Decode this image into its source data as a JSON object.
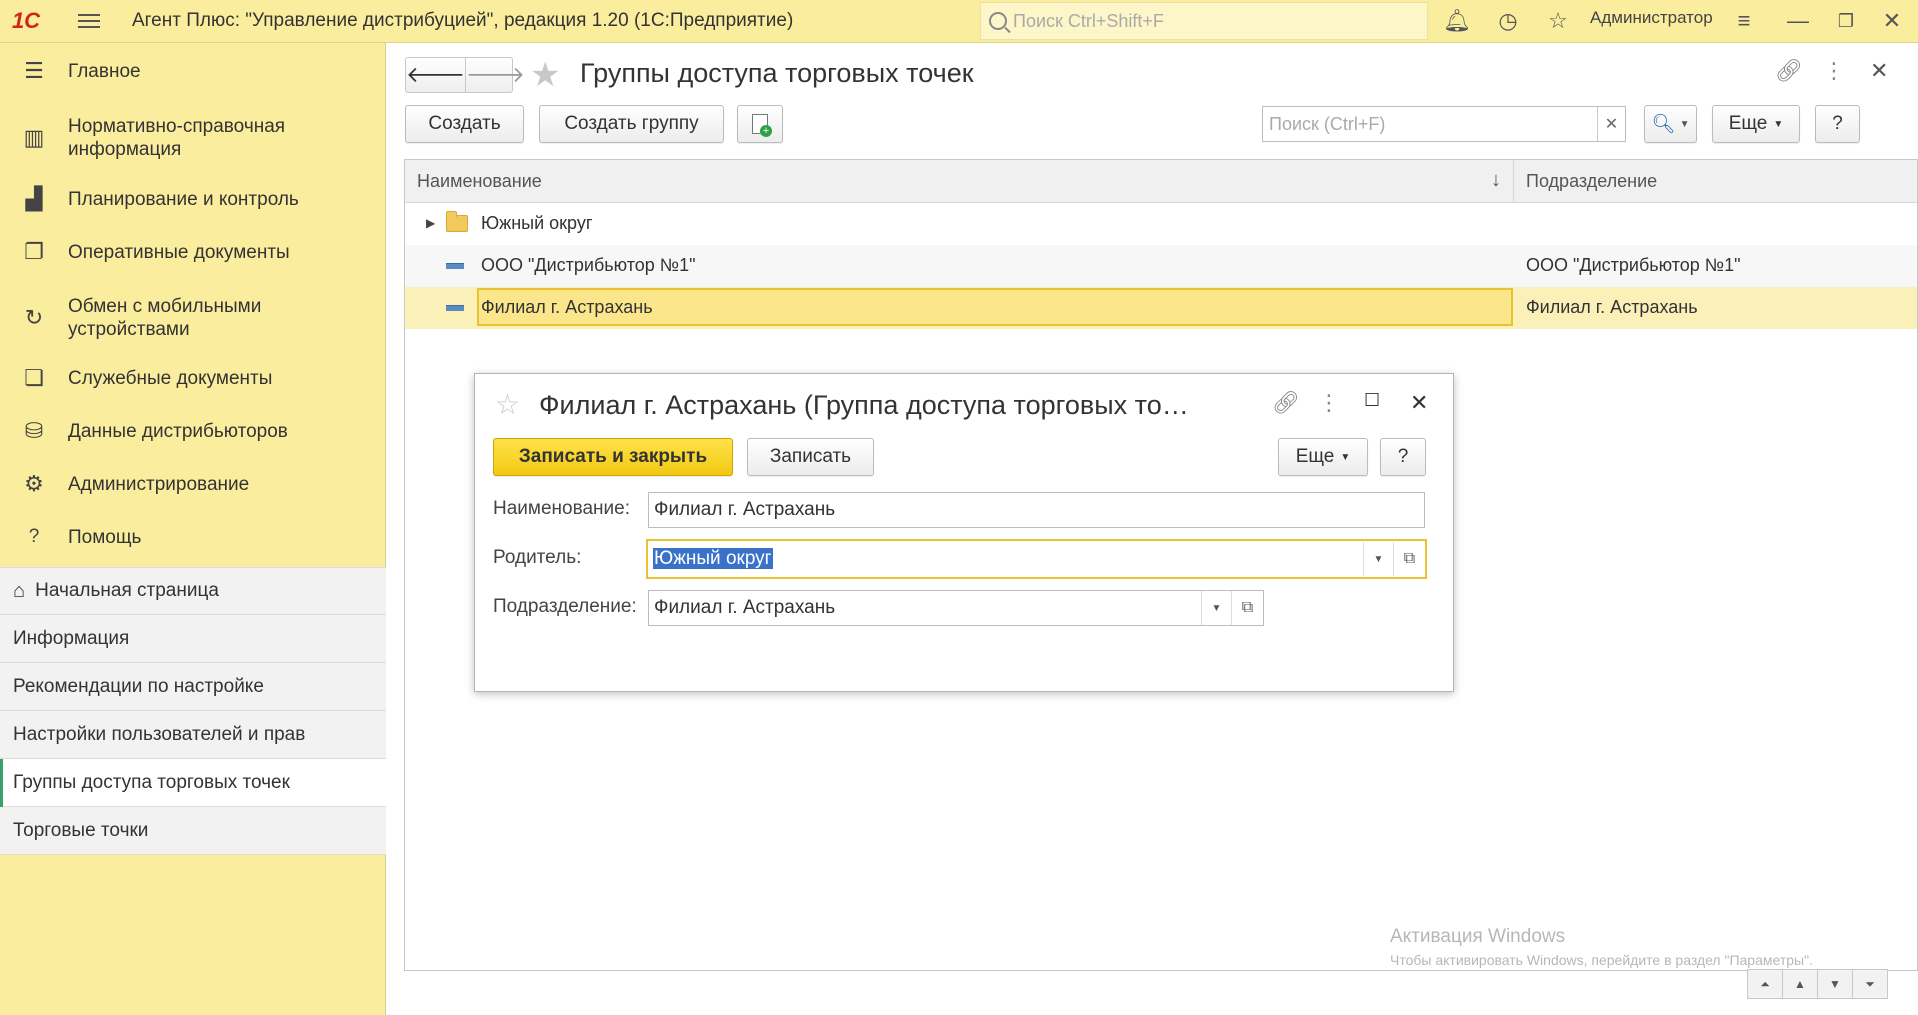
{
  "topbar": {
    "logo": "1С",
    "title": "Агент Плюс: \"Управление дистрибуцией\", редакция 1.20  (1С:Предприятие)",
    "search_placeholder": "Поиск Ctrl+Shift+F",
    "user": "Администратор"
  },
  "sidebar": {
    "sections": [
      {
        "label": "Главное",
        "icon": "list-icon"
      },
      {
        "label": "Нормативно-справочная информация",
        "icon": "book-icon"
      },
      {
        "label": "Планирование и контроль",
        "icon": "chart-icon"
      },
      {
        "label": "Оперативные документы",
        "icon": "documents-icon"
      },
      {
        "label": "Обмен с мобильными устройствами",
        "icon": "sync-icon"
      },
      {
        "label": "Служебные документы",
        "icon": "service-docs-icon"
      },
      {
        "label": "Данные дистрибьюторов",
        "icon": "database-icon"
      },
      {
        "label": "Администрирование",
        "icon": "gear-icon"
      },
      {
        "label": "Помощь",
        "icon": "help-icon"
      }
    ],
    "open_windows": [
      {
        "label": "Начальная страница"
      },
      {
        "label": "Информация"
      },
      {
        "label": "Рекомендации по настройке"
      },
      {
        "label": "Настройки пользователей и прав"
      },
      {
        "label": "Группы доступа торговых точек"
      },
      {
        "label": "Торговые точки"
      }
    ]
  },
  "main": {
    "title": "Группы доступа торговых точек",
    "toolbar": {
      "create": "Создать",
      "create_group": "Создать группу",
      "search_placeholder": "Поиск (Ctrl+F)",
      "more": "Еще",
      "help": "?"
    },
    "table": {
      "columns": [
        "Наименование",
        "Подразделение"
      ],
      "sort_indicator": "↓",
      "rows": [
        {
          "name": "Южный округ",
          "division": "",
          "type": "folder"
        },
        {
          "name": "ООО \"Дистрибьютор №1\"",
          "division": "ООО \"Дистрибьютор №1\"",
          "type": "item"
        },
        {
          "name": "Филиал г. Астрахань",
          "division": "Филиал г. Астрахань",
          "type": "item",
          "selected": true
        }
      ]
    }
  },
  "dialog": {
    "title": "Филиал г. Астрахань (Группа доступа торговых то…",
    "save_close": "Записать и закрыть",
    "save": "Записать",
    "more": "Еще",
    "help": "?",
    "fields": {
      "name_label": "Наименование:",
      "name_value": "Филиал г. Астрахань",
      "parent_label": "Родитель:",
      "parent_value": "Южный округ",
      "division_label": "Подразделение:",
      "division_value": "Филиал г. Астрахань"
    }
  },
  "watermark": {
    "line1": "Активация Windows",
    "line2": "Чтобы активировать Windows, перейдите в раздел \"Параметры\"."
  }
}
